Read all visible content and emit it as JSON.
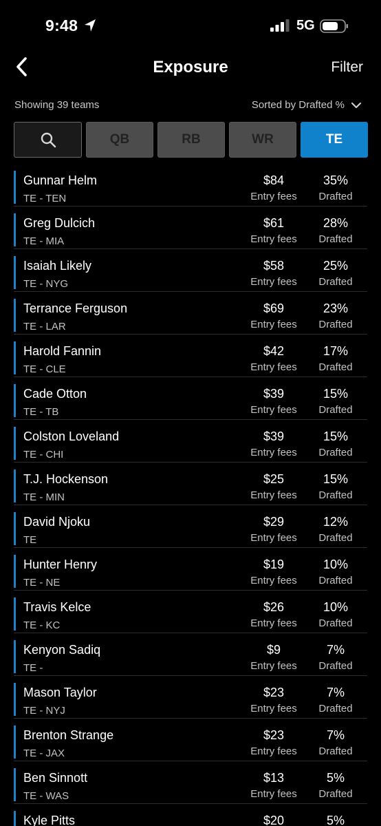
{
  "status_bar": {
    "time": "9:48",
    "network": "5G"
  },
  "nav": {
    "title": "Exposure",
    "filter_label": "Filter"
  },
  "subheader": {
    "count_text": "Showing 39 teams",
    "sort_text": "Sorted by Drafted %"
  },
  "filters": {
    "positions": [
      {
        "label": "QB",
        "active": false
      },
      {
        "label": "RB",
        "active": false
      },
      {
        "label": "WR",
        "active": false
      },
      {
        "label": "TE",
        "active": true
      }
    ]
  },
  "colors": {
    "accent": "#1082cc",
    "row_bar": "#1e82c8",
    "background": "#000000"
  },
  "players": [
    {
      "name": "Gunnar Helm",
      "pos": "TE - TEN",
      "fee": "$84",
      "fee_label": "Entry fees",
      "pct": "35%",
      "pct_label": "Drafted"
    },
    {
      "name": "Greg Dulcich",
      "pos": "TE - MIA",
      "fee": "$61",
      "fee_label": "Entry fees",
      "pct": "28%",
      "pct_label": "Drafted"
    },
    {
      "name": "Isaiah Likely",
      "pos": "TE - NYG",
      "fee": "$58",
      "fee_label": "Entry fees",
      "pct": "25%",
      "pct_label": "Drafted"
    },
    {
      "name": "Terrance Ferguson",
      "pos": "TE - LAR",
      "fee": "$69",
      "fee_label": "Entry fees",
      "pct": "23%",
      "pct_label": "Drafted"
    },
    {
      "name": "Harold Fannin",
      "pos": "TE - CLE",
      "fee": "$42",
      "fee_label": "Entry fees",
      "pct": "17%",
      "pct_label": "Drafted"
    },
    {
      "name": "Cade Otton",
      "pos": "TE - TB",
      "fee": "$39",
      "fee_label": "Entry fees",
      "pct": "15%",
      "pct_label": "Drafted"
    },
    {
      "name": "Colston Loveland",
      "pos": "TE - CHI",
      "fee": "$39",
      "fee_label": "Entry fees",
      "pct": "15%",
      "pct_label": "Drafted"
    },
    {
      "name": "T.J. Hockenson",
      "pos": "TE - MIN",
      "fee": "$25",
      "fee_label": "Entry fees",
      "pct": "15%",
      "pct_label": "Drafted"
    },
    {
      "name": "David Njoku",
      "pos": "TE",
      "fee": "$29",
      "fee_label": "Entry fees",
      "pct": "12%",
      "pct_label": "Drafted"
    },
    {
      "name": "Hunter Henry",
      "pos": "TE - NE",
      "fee": "$19",
      "fee_label": "Entry fees",
      "pct": "10%",
      "pct_label": "Drafted"
    },
    {
      "name": "Travis Kelce",
      "pos": "TE - KC",
      "fee": "$26",
      "fee_label": "Entry fees",
      "pct": "10%",
      "pct_label": "Drafted"
    },
    {
      "name": "Kenyon Sadiq",
      "pos": "TE -",
      "fee": "$9",
      "fee_label": "Entry fees",
      "pct": "7%",
      "pct_label": "Drafted"
    },
    {
      "name": "Mason Taylor",
      "pos": "TE - NYJ",
      "fee": "$23",
      "fee_label": "Entry fees",
      "pct": "7%",
      "pct_label": "Drafted"
    },
    {
      "name": "Brenton Strange",
      "pos": "TE - JAX",
      "fee": "$23",
      "fee_label": "Entry fees",
      "pct": "7%",
      "pct_label": "Drafted"
    },
    {
      "name": "Ben Sinnott",
      "pos": "TE - WAS",
      "fee": "$13",
      "fee_label": "Entry fees",
      "pct": "5%",
      "pct_label": "Drafted"
    },
    {
      "name": "Kyle Pitts",
      "pos": "",
      "fee": "$20",
      "fee_label": "",
      "pct": "5%",
      "pct_label": ""
    }
  ]
}
